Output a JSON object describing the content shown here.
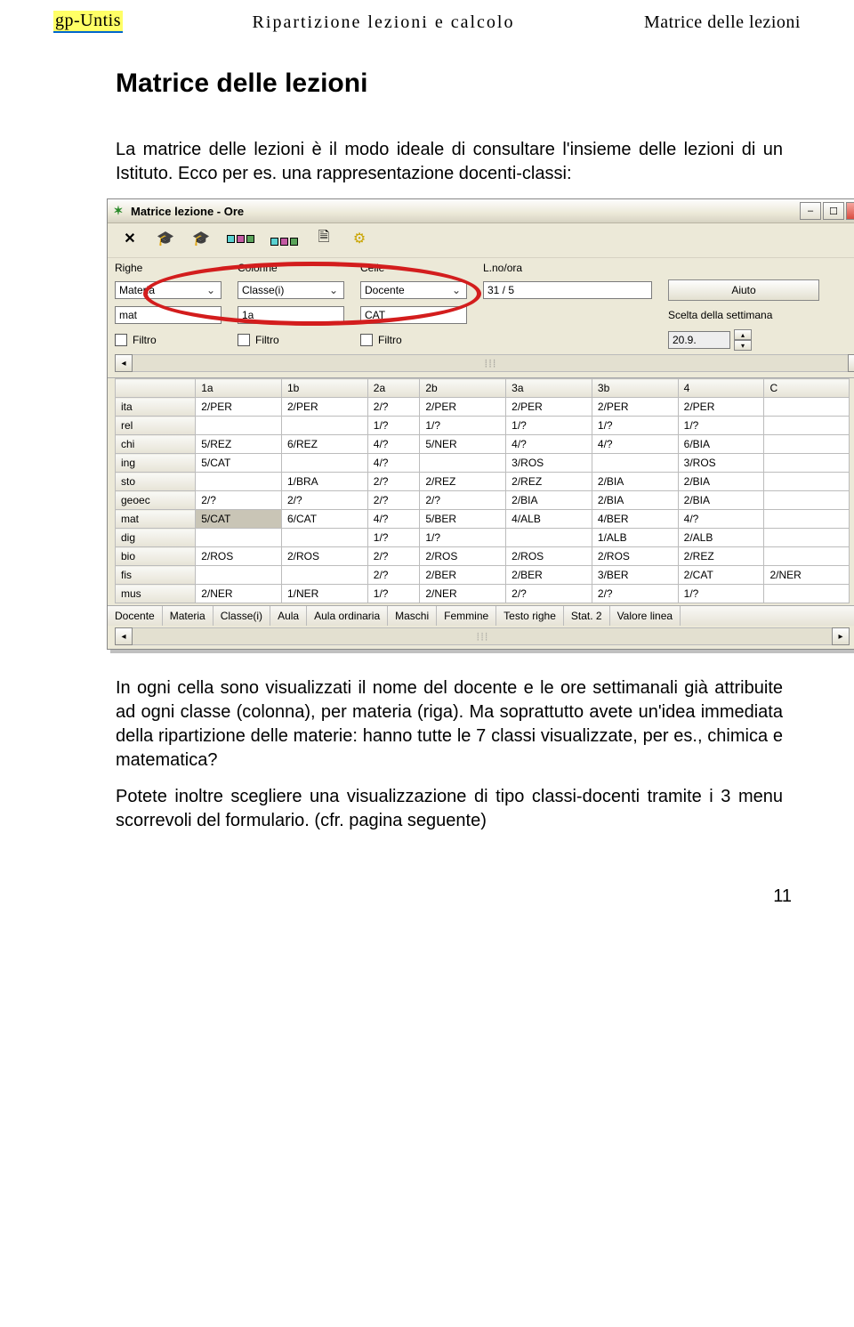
{
  "header": {
    "brand": "gp-Untis",
    "center": "Ripartizione lezioni e calcolo",
    "right": "Matrice delle lezioni"
  },
  "title": "Matrice delle lezioni",
  "para1": "La matrice delle lezioni è il modo ideale di consultare l'insieme delle lezioni di un Istituto. Ecco per es. una rappresentazione docenti-classi:",
  "para2": "In ogni cella sono visualizzati il nome del docente e le ore settimanali già attribuite ad ogni classe (colonna), per materia (riga). Ma soprattutto avete un'idea immediata della ripartizione delle materie: hanno tutte le 7 classi visualizzate, per es., chimica e matematica?",
  "para3": "Potete inoltre scegliere una visualizzazione di tipo classi-docenti tramite i 3 menu scorrevoli del formulario. (cfr. pagina seguente)",
  "page_number": "11",
  "app": {
    "title": "Matrice lezione - Ore",
    "controls": {
      "righe_label": "Righe",
      "colonne_label": "Colonne",
      "celle_label": "Celle",
      "lno_label": "L.no/ora",
      "righe_value": "Materia",
      "colonne_value": "Classe(i)",
      "celle_value": "Docente",
      "lno_value": "31 / 5",
      "righe_sub": "mat",
      "colonne_sub": "1a",
      "celle_sub": "CAT",
      "filtro_label": "Filtro",
      "aiuto_label": "Aiuto",
      "scelta_label": "Scelta della settimana",
      "scelta_value": "20.9."
    },
    "columns": [
      "",
      "1a",
      "1b",
      "2a",
      "2b",
      "3a",
      "3b",
      "4",
      "C"
    ],
    "rows": [
      {
        "h": "ita",
        "c": [
          "2/PER",
          "2/PER",
          "2/?",
          "2/PER",
          "2/PER",
          "2/PER",
          "2/PER",
          ""
        ]
      },
      {
        "h": "rel",
        "c": [
          "",
          "",
          "1/?",
          "1/?",
          "1/?",
          "1/?",
          "1/?",
          ""
        ]
      },
      {
        "h": "chi",
        "c": [
          "5/REZ",
          "6/REZ",
          "4/?",
          "5/NER",
          "4/?",
          "4/?",
          "6/BIA",
          ""
        ]
      },
      {
        "h": "ing",
        "c": [
          "5/CAT",
          "",
          "4/?",
          "",
          "3/ROS",
          "",
          "3/ROS",
          ""
        ]
      },
      {
        "h": "sto",
        "c": [
          "",
          "1/BRA",
          "2/?",
          "2/REZ",
          "2/REZ",
          "2/BIA",
          "2/BIA",
          ""
        ]
      },
      {
        "h": "geoec",
        "c": [
          "2/?",
          "2/?",
          "2/?",
          "2/?",
          "2/BIA",
          "2/BIA",
          "2/BIA",
          ""
        ]
      },
      {
        "h": "mat",
        "c": [
          "5/CAT",
          "6/CAT",
          "4/?",
          "5/BER",
          "4/ALB",
          "4/BER",
          "4/?",
          ""
        ],
        "sel": 0
      },
      {
        "h": "dig",
        "c": [
          "",
          "",
          "1/?",
          "1/?",
          "",
          "1/ALB",
          "2/ALB",
          ""
        ]
      },
      {
        "h": "bio",
        "c": [
          "2/ROS",
          "2/ROS",
          "2/?",
          "2/ROS",
          "2/ROS",
          "2/ROS",
          "2/REZ",
          ""
        ]
      },
      {
        "h": "fis",
        "c": [
          "",
          "",
          "2/?",
          "2/BER",
          "2/BER",
          "3/BER",
          "2/CAT",
          "2/NER"
        ]
      },
      {
        "h": "mus",
        "c": [
          "2/NER",
          "1/NER",
          "1/?",
          "2/NER",
          "2/?",
          "2/?",
          "1/?",
          ""
        ]
      }
    ],
    "bottom": [
      "Docente",
      "Materia",
      "Classe(i)",
      "Aula",
      "Aula ordinaria",
      "Maschi",
      "Femmine",
      "Testo righe",
      "Stat. 2",
      "Valore linea"
    ]
  }
}
